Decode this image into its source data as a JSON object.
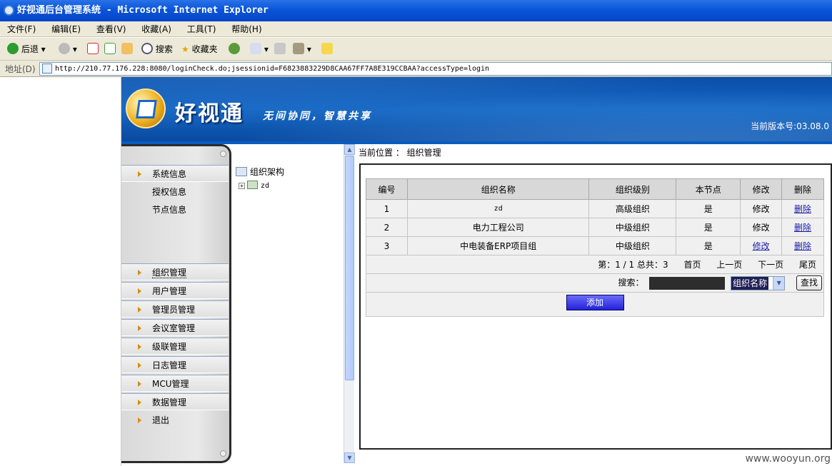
{
  "window": {
    "title": "好视通后台管理系统 - Microsoft Internet Explorer"
  },
  "menubar": [
    "文件(F)",
    "编辑(E)",
    "查看(V)",
    "收藏(A)",
    "工具(T)",
    "帮助(H)"
  ],
  "toolbar": {
    "back": "后退",
    "search": "搜索",
    "favorites": "收藏夹"
  },
  "address": {
    "label": "地址(D)",
    "url": "http://210.77.176.228:8080/loginCheck.do;jsessionid=F6823883229D8CAA67FF7A8E319CCBAA?accessType=login"
  },
  "banner": {
    "brand": "好视通",
    "slogan": "无间协同，智慧共享",
    "version": "当前版本号:03.08.0"
  },
  "nav": {
    "system_info": "系统信息",
    "auth_info": "授权信息",
    "node_info": "节点信息",
    "items": [
      "组织管理",
      "用户管理",
      "管理员管理",
      "会议室管理",
      "级联管理",
      "日志管理",
      "MCU管理",
      "数据管理",
      "退出"
    ]
  },
  "tree": {
    "root": "组织架构",
    "child": "zd"
  },
  "breadcrumb": "当前位置 ： 组织管理",
  "table": {
    "headers": [
      "编号",
      "组织名称",
      "组织级别",
      "本节点",
      "修改",
      "删除"
    ],
    "rows": [
      {
        "id": "1",
        "name": "zd",
        "level": "高级组织",
        "local": "是",
        "edit": "修改",
        "delete": "删除"
      },
      {
        "id": "2",
        "name": "电力工程公司",
        "level": "中级组织",
        "local": "是",
        "edit": "修改",
        "delete": "删除"
      },
      {
        "id": "3",
        "name": "中电装备ERP项目组",
        "level": "中级组织",
        "local": "是",
        "edit": "修改",
        "delete": "删除"
      }
    ]
  },
  "pager": {
    "info": "第：1 / 1 总共：3",
    "first": "首页",
    "prev": "上一页",
    "next": "下一页",
    "last": "尾页"
  },
  "search": {
    "label": "搜索：",
    "field": "组织名称",
    "button": "查找"
  },
  "add_button": "添加",
  "watermark": "www.wooyun.org"
}
